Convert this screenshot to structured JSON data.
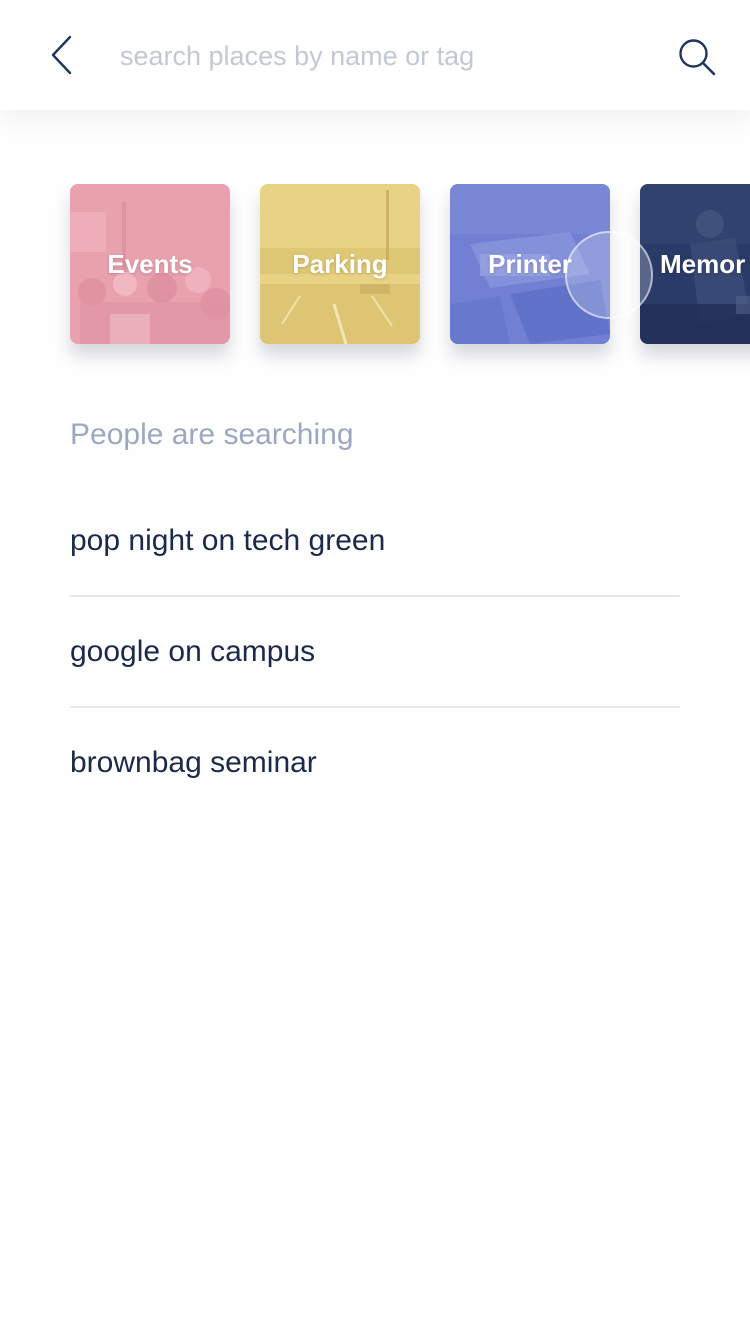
{
  "search": {
    "placeholder": "search places by name or tag",
    "value": ""
  },
  "icons": {
    "back": "chevron-left-icon",
    "search": "magnifier-icon"
  },
  "categories": [
    {
      "label": "Events",
      "color": "#e8a0ae"
    },
    {
      "label": "Parking",
      "color": "#e6cf7e"
    },
    {
      "label": "Printer",
      "color": "#6f7fd0"
    },
    {
      "label": "Memor",
      "color": "#2c3d6b"
    }
  ],
  "trending": {
    "title": "People are searching",
    "items": [
      {
        "label": "pop night on tech green"
      },
      {
        "label": "google on campus"
      },
      {
        "label": "brownbag seminar"
      }
    ]
  },
  "colors": {
    "primary_text": "#1b2a4a",
    "secondary_text": "#9aa8c2",
    "icon": "#1f3560"
  }
}
